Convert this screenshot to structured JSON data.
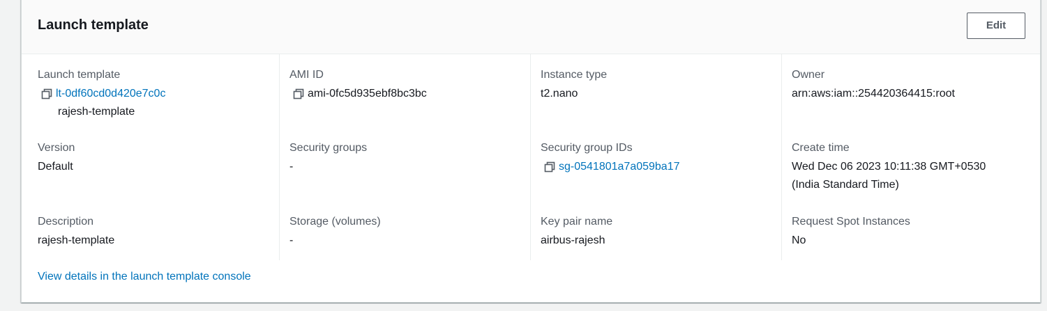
{
  "header": {
    "title": "Launch template",
    "edit_label": "Edit"
  },
  "fields": {
    "launch_template": {
      "label": "Launch template",
      "id": "lt-0df60cd0d420e7c0c",
      "name": "rajesh-template"
    },
    "ami_id": {
      "label": "AMI ID",
      "value": "ami-0fc5d935ebf8bc3bc"
    },
    "instance_type": {
      "label": "Instance type",
      "value": "t2.nano"
    },
    "owner": {
      "label": "Owner",
      "value": "arn:aws:iam::254420364415:root"
    },
    "version": {
      "label": "Version",
      "value": "Default"
    },
    "security_groups": {
      "label": "Security groups",
      "value": "-"
    },
    "security_group_ids": {
      "label": "Security group IDs",
      "value": "sg-0541801a7a059ba17"
    },
    "create_time": {
      "label": "Create time",
      "line1": "Wed Dec 06 2023 10:11:38 GMT+0530",
      "line2": "(India Standard Time)"
    },
    "description": {
      "label": "Description",
      "value": "rajesh-template"
    },
    "storage": {
      "label": "Storage (volumes)",
      "value": "-"
    },
    "key_pair": {
      "label": "Key pair name",
      "value": "airbus-rajesh"
    },
    "spot": {
      "label": "Request Spot Instances",
      "value": "No"
    }
  },
  "footer": {
    "link_label": "View details in the launch template console"
  },
  "colors": {
    "link": "#0073bb",
    "label": "#545b64",
    "text": "#16191f"
  },
  "icons": {
    "copy": "copy-icon"
  }
}
